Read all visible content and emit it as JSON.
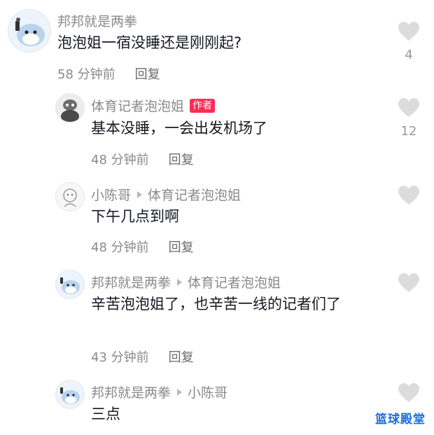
{
  "comments": [
    {
      "user": "邦邦就是两拳",
      "text": "泡泡姐一宿没睡还是刚刚起?",
      "time": "58 分钟前",
      "reply": "回复",
      "likes": "4"
    },
    {
      "user": "体育记者泡泡姐",
      "badge": "作者",
      "text": "基本没睡，一会出发机场了",
      "time": "48 分钟前",
      "reply": "回复",
      "likes": "12"
    },
    {
      "user": "小陈哥",
      "reply_to": "体育记者泡泡姐",
      "text": "下午几点到啊",
      "time": "48 分钟前",
      "reply": "回复"
    },
    {
      "user": "邦邦就是两拳",
      "reply_to": "体育记者泡泡姐",
      "text": "辛苦泡泡姐了，也辛苦一线的记者们了",
      "time": "43 分钟前",
      "reply": "回复"
    },
    {
      "user": "邦邦就是两拳",
      "reply_to": "小陈哥",
      "text": "三点"
    }
  ],
  "icons": {
    "like": "heart-icon",
    "reply_arrow": "triangle-right-icon"
  },
  "watermark": "篮球殿堂",
  "colors": {
    "badge": "#fe2c55",
    "text": "#161823",
    "meta": "#8a8a8a",
    "heart": "#dcdcdc",
    "watermark": "#1a6fd8"
  }
}
